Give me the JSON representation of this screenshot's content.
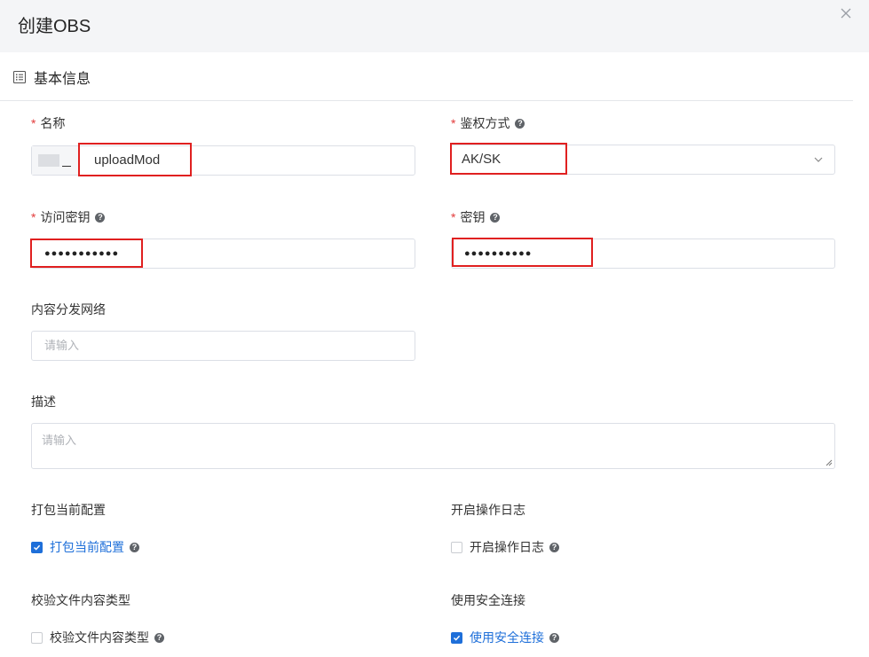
{
  "dialog": {
    "title": "创建OBS",
    "close_icon": "close-icon"
  },
  "section": {
    "title": "基本信息",
    "icon": "list-icon"
  },
  "fields": {
    "name": {
      "label": "名称",
      "required": "*",
      "value": "uploadMod"
    },
    "auth_method": {
      "label": "鉴权方式",
      "required": "*",
      "value": "AK/SK",
      "icon": "chevron-down-icon"
    },
    "access_key": {
      "label": "访问密钥",
      "required": "*",
      "value": "●●●●●●●●●●●"
    },
    "secret_key": {
      "label": "密钥",
      "required": "*",
      "value": "●●●●●●●●●●"
    },
    "cdn": {
      "label": "内容分发网络",
      "placeholder": "请输入"
    },
    "description": {
      "label": "描述",
      "placeholder": "请输入"
    }
  },
  "options": {
    "package_config": {
      "label": "打包当前配置",
      "checkbox_label": "打包当前配置",
      "checked": true
    },
    "operation_log": {
      "label": "开启操作日志",
      "checkbox_label": "开启操作日志",
      "checked": false
    },
    "verify_content_type": {
      "label": "校验文件内容类型",
      "checkbox_label": "校验文件内容类型",
      "checked": false
    },
    "secure_connection": {
      "label": "使用安全连接",
      "checkbox_label": "使用安全连接",
      "checked": true
    }
  },
  "colors": {
    "accent": "#1e6fd9",
    "required": "#e23b3b",
    "highlight": "#e02020",
    "header_bg": "#f4f5f7"
  }
}
